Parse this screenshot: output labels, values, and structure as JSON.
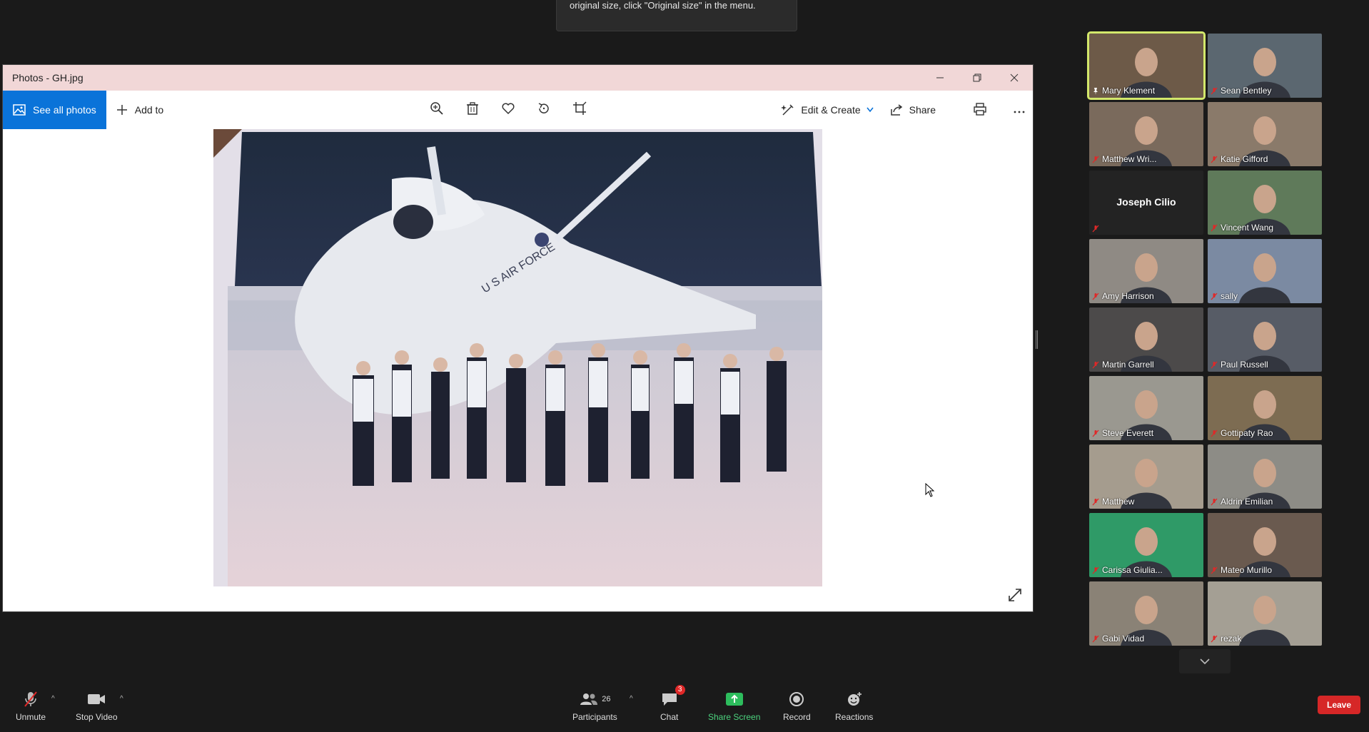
{
  "tooltip": {
    "text": "original size, click \"Original size\" in the menu."
  },
  "photos": {
    "window_title": "Photos - GH.jpg",
    "see_all_label": "See all photos",
    "add_to_label": "Add to",
    "edit_create_label": "Edit & Create",
    "share_label": "Share"
  },
  "gallery": {
    "participants": [
      {
        "name": "Mary Klement",
        "active": true
      },
      {
        "name": "Sean Bentley"
      },
      {
        "name": "Matthew Wri..."
      },
      {
        "name": "Katie Gifford"
      },
      {
        "name": "Joseph Cilio",
        "video_off": true
      },
      {
        "name": "Vincent Wang"
      },
      {
        "name": "Amy Harrison"
      },
      {
        "name": "sally"
      },
      {
        "name": "Martin Garrell"
      },
      {
        "name": "Paul Russell"
      },
      {
        "name": "Steve Everett"
      },
      {
        "name": "Gottipaty Rao"
      },
      {
        "name": "Matthew"
      },
      {
        "name": "Aldrin Emilian"
      },
      {
        "name": "Carissa Giulia..."
      },
      {
        "name": "Mateo Murillo"
      },
      {
        "name": "Gabi Vidad"
      },
      {
        "name": "rezak"
      }
    ]
  },
  "bottombar": {
    "unmute_label": "Unmute",
    "stop_video_label": "Stop Video",
    "participants_label": "Participants",
    "participants_count": "26",
    "chat_label": "Chat",
    "chat_badge": "3",
    "share_screen_label": "Share Screen",
    "record_label": "Record",
    "reactions_label": "Reactions",
    "leave_label": "Leave"
  },
  "colors": {
    "accent_blue": "#0a73d9",
    "titlebar_pink": "#f1d7d7",
    "active_speaker": "#d3e86b",
    "leave_red": "#d62727",
    "share_green": "#4cd37e"
  }
}
